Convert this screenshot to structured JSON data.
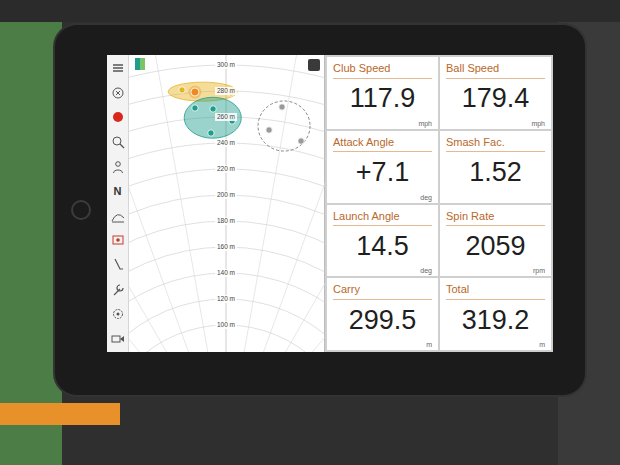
{
  "app": {
    "sidebar_letter": "N"
  },
  "map": {
    "rings": [
      {
        "distance": 300,
        "label": "300 m"
      },
      {
        "distance": 280,
        "label": "280 m"
      },
      {
        "distance": 260,
        "label": "260 m"
      },
      {
        "distance": 240,
        "label": "240 m"
      },
      {
        "distance": 220,
        "label": "220 m"
      },
      {
        "distance": 200,
        "label": "200 m"
      },
      {
        "distance": 180,
        "label": "180 m"
      },
      {
        "distance": 160,
        "label": "160 m"
      },
      {
        "distance": 140,
        "label": "140 m"
      },
      {
        "distance": 120,
        "label": "120 m"
      },
      {
        "distance": 100,
        "label": "100 m"
      }
    ],
    "groups": [
      {
        "color": "#e6b422",
        "active": true,
        "points": [
          {
            "lateral": -27.5,
            "distance": 280.8,
            "selected": false
          },
          {
            "lateral": -19.4,
            "distance": 279.2,
            "selected": true
          },
          {
            "lateral": 3.1,
            "distance": 278.5,
            "selected": false
          }
        ]
      },
      {
        "color": "#1f9e8c",
        "active": true,
        "points": [
          {
            "lateral": -19.4,
            "distance": 266.9,
            "selected": false
          },
          {
            "lateral": -8.1,
            "distance": 266.2,
            "selected": false
          },
          {
            "lateral": 3.8,
            "distance": 256.9,
            "selected": false
          },
          {
            "lateral": -9.4,
            "distance": 247.7,
            "selected": false
          }
        ]
      },
      {
        "color": "#9a9a9a",
        "active": false,
        "points": [
          {
            "lateral": 35.0,
            "distance": 267.7,
            "selected": false
          },
          {
            "lateral": 26.9,
            "distance": 250.0,
            "selected": false
          },
          {
            "lateral": 46.9,
            "distance": 241.5,
            "selected": false
          }
        ]
      }
    ]
  },
  "tiles": [
    {
      "label": "Club Speed",
      "value": "117.9",
      "unit": "mph"
    },
    {
      "label": "Ball Speed",
      "value": "179.4",
      "unit": "mph"
    },
    {
      "label": "Attack Angle",
      "value": "+7.1",
      "unit": "deg"
    },
    {
      "label": "Smash Fac.",
      "value": "1.52"
    },
    {
      "label": "Launch Angle",
      "value": "14.5",
      "unit": "deg"
    },
    {
      "label": "Spin Rate",
      "value": "2059",
      "unit": "rpm"
    },
    {
      "label": "Carry",
      "value": "299.5",
      "unit": "m"
    },
    {
      "label": "Total",
      "value": "319.2",
      "unit": "m"
    }
  ]
}
